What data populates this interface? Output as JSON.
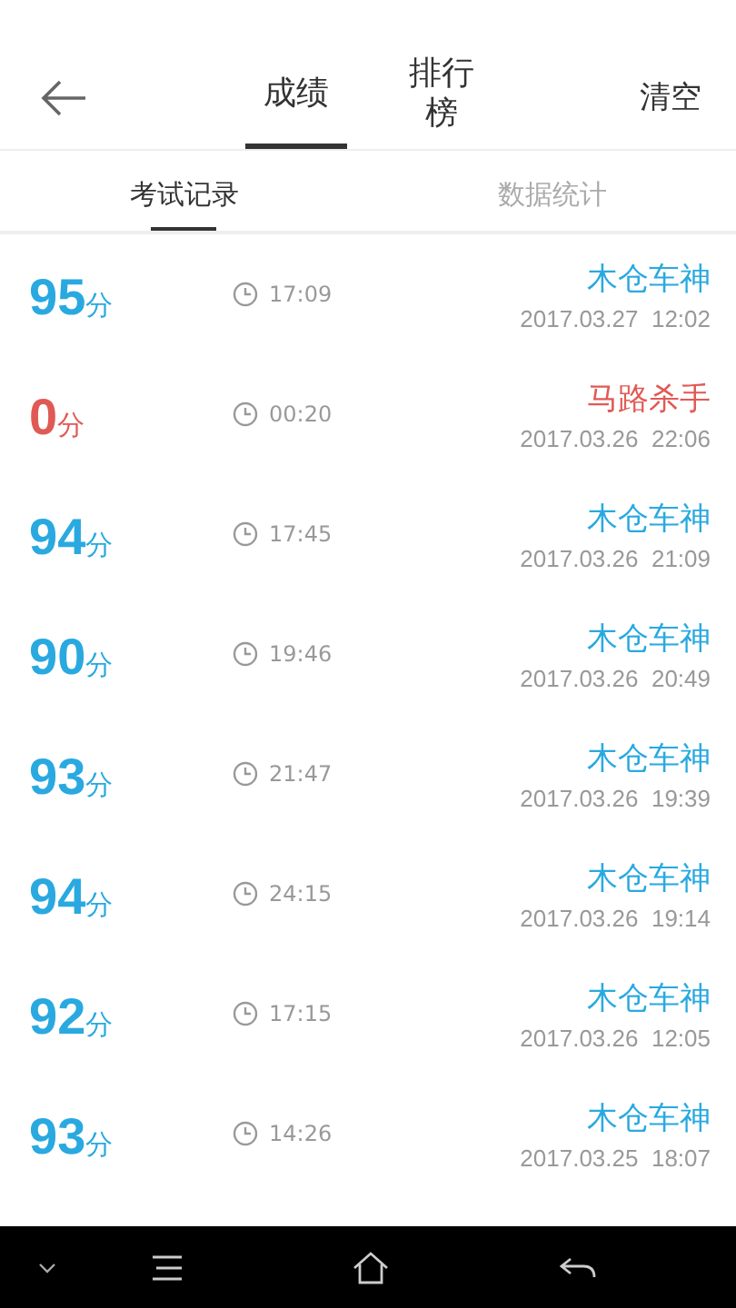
{
  "header": {
    "tabs": [
      {
        "label": "成绩",
        "selected": true
      },
      {
        "label": "排行榜",
        "selected": false
      }
    ],
    "action": "清空"
  },
  "subtabs": [
    {
      "label": "考试记录",
      "selected": true
    },
    {
      "label": "数据统计",
      "selected": false
    }
  ],
  "records": [
    {
      "score": "95",
      "unit": "分",
      "duration": "17:09",
      "title": "木仓车神",
      "date": "2017.03.27  12:02",
      "color": "#29a9e0"
    },
    {
      "score": "0",
      "unit": "分",
      "duration": "00:20",
      "title": "马路杀手",
      "date": "2017.03.26  22:06",
      "color": "#e05a55"
    },
    {
      "score": "94",
      "unit": "分",
      "duration": "17:45",
      "title": "木仓车神",
      "date": "2017.03.26  21:09",
      "color": "#29a9e0"
    },
    {
      "score": "90",
      "unit": "分",
      "duration": "19:46",
      "title": "木仓车神",
      "date": "2017.03.26  20:49",
      "color": "#29a9e0"
    },
    {
      "score": "93",
      "unit": "分",
      "duration": "21:47",
      "title": "木仓车神",
      "date": "2017.03.26  19:39",
      "color": "#29a9e0"
    },
    {
      "score": "94",
      "unit": "分",
      "duration": "24:15",
      "title": "木仓车神",
      "date": "2017.03.26  19:14",
      "color": "#29a9e0"
    },
    {
      "score": "92",
      "unit": "分",
      "duration": "17:15",
      "title": "木仓车神",
      "date": "2017.03.26  12:05",
      "color": "#29a9e0"
    },
    {
      "score": "93",
      "unit": "分",
      "duration": "14:26",
      "title": "木仓车神",
      "date": "2017.03.25  18:07",
      "color": "#29a9e0"
    }
  ]
}
